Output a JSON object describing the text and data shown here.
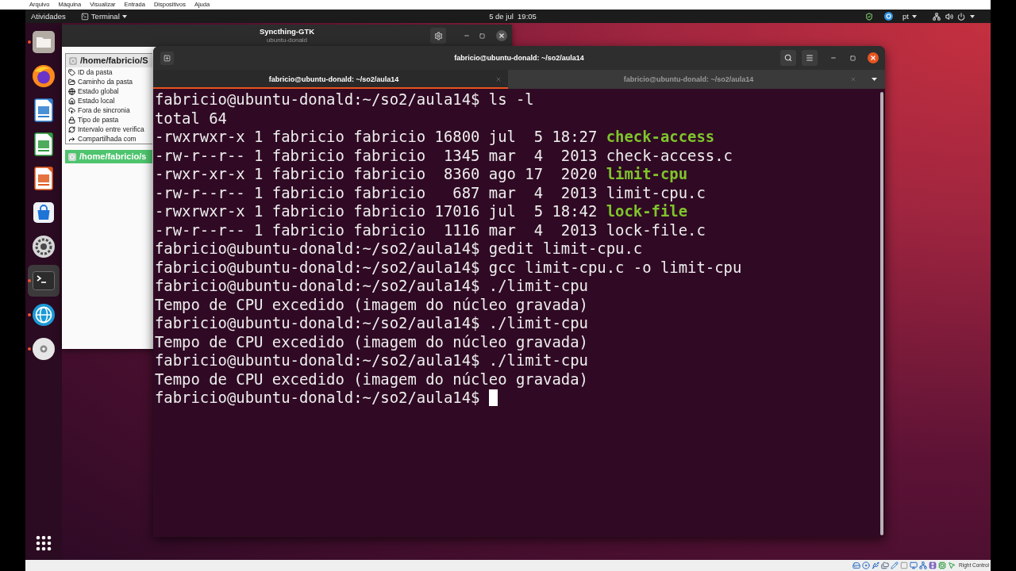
{
  "vm_window": {
    "menu": [
      "Arquivo",
      "Máquina",
      "Visualizar",
      "Entrada",
      "Dispositivos",
      "Ajuda"
    ],
    "status_bar": {
      "host_key": "Right Control"
    }
  },
  "top_bar": {
    "activities": "Atividades",
    "app_menu": "Terminal",
    "clock": "5 de jul  19:05",
    "keyboard_layout": "pt"
  },
  "dock": {
    "items": [
      {
        "kind": "files",
        "running": true,
        "selected": false
      },
      {
        "kind": "browser",
        "running": false,
        "selected": false
      },
      {
        "kind": "writer",
        "running": false,
        "selected": false
      },
      {
        "kind": "calc",
        "running": false,
        "selected": false
      },
      {
        "kind": "impress",
        "running": false,
        "selected": false
      },
      {
        "kind": "software",
        "running": false,
        "selected": false
      },
      {
        "kind": "settings",
        "running": false,
        "selected": false
      },
      {
        "kind": "terminal",
        "running": true,
        "selected": true
      },
      {
        "kind": "sync",
        "running": true,
        "selected": false
      },
      {
        "kind": "disc",
        "running": true,
        "selected": false
      }
    ]
  },
  "syncthing_window": {
    "title": "Syncthing-GTK",
    "subtitle": "ubuntu-donald",
    "folders": [
      {
        "path": "/home/fabricio/S",
        "expanded": true,
        "selected": false,
        "details": [
          {
            "kind": "id",
            "label": "ID da pasta"
          },
          {
            "kind": "path",
            "label": "Caminho da pasta"
          },
          {
            "kind": "global",
            "label": "Estado global"
          },
          {
            "kind": "local",
            "label": "Estado local"
          },
          {
            "kind": "out_of_sync",
            "label": "Fora de sincronia"
          },
          {
            "kind": "type",
            "label": "Tipo de pasta"
          },
          {
            "kind": "rescan",
            "label": "Intervalo entre verifica"
          },
          {
            "kind": "shared",
            "label": "Compartilhada com"
          }
        ]
      },
      {
        "path": "/home/fabricio/s",
        "expanded": false,
        "selected": true
      }
    ]
  },
  "terminal_window": {
    "title": "fabricio@ubuntu-donald: ~/so2/aula14",
    "tabs": [
      {
        "title": "fabricio@ubuntu-donald: ~/so2/aula14",
        "selected": true
      },
      {
        "title": "fabricio@ubuntu-donald: ~/so2/aula14",
        "selected": false
      }
    ],
    "lines": [
      {
        "kind": "prompt",
        "prompt": "fabricio@ubuntu-donald:~/so2/aula14$",
        "command": "ls -l",
        "cursor": false
      },
      {
        "kind": "output",
        "text": "total 64"
      },
      {
        "kind": "listing",
        "info": "-rwxrwxr-x 1 fabricio fabricio 16800 jul  5 18:27",
        "name": "check-access",
        "executable": true
      },
      {
        "kind": "listing",
        "info": "-rw-r--r-- 1 fabricio fabricio  1345 mar  4  2013",
        "name": "check-access.c",
        "executable": false
      },
      {
        "kind": "listing",
        "info": "-rwxr-xr-x 1 fabricio fabricio  8360 ago 17  2020",
        "name": "limit-cpu",
        "executable": true
      },
      {
        "kind": "listing",
        "info": "-rw-r--r-- 1 fabricio fabricio   687 mar  4  2013",
        "name": "limit-cpu.c",
        "executable": false
      },
      {
        "kind": "listing",
        "info": "-rwxrwxr-x 1 fabricio fabricio 17016 jul  5 18:42",
        "name": "lock-file",
        "executable": true
      },
      {
        "kind": "listing",
        "info": "-rw-r--r-- 1 fabricio fabricio  1116 mar  4  2013",
        "name": "lock-file.c",
        "executable": false
      },
      {
        "kind": "prompt",
        "prompt": "fabricio@ubuntu-donald:~/so2/aula14$",
        "command": "gedit limit-cpu.c",
        "cursor": false
      },
      {
        "kind": "prompt",
        "prompt": "fabricio@ubuntu-donald:~/so2/aula14$",
        "command": "gcc limit-cpu.c -o limit-cpu",
        "cursor": false
      },
      {
        "kind": "prompt",
        "prompt": "fabricio@ubuntu-donald:~/so2/aula14$",
        "command": "./limit-cpu",
        "cursor": false
      },
      {
        "kind": "output",
        "text": "Tempo de CPU excedido (imagem do núcleo gravada)"
      },
      {
        "kind": "prompt",
        "prompt": "fabricio@ubuntu-donald:~/so2/aula14$",
        "command": "./limit-cpu",
        "cursor": false
      },
      {
        "kind": "output",
        "text": "Tempo de CPU excedido (imagem do núcleo gravada)"
      },
      {
        "kind": "prompt",
        "prompt": "fabricio@ubuntu-donald:~/so2/aula14$",
        "command": "./limit-cpu",
        "cursor": false
      },
      {
        "kind": "output",
        "text": "Tempo de CPU excedido (imagem do núcleo gravada)"
      },
      {
        "kind": "prompt",
        "prompt": "fabricio@ubuntu-donald:~/so2/aula14$",
        "cursor": true
      }
    ]
  }
}
